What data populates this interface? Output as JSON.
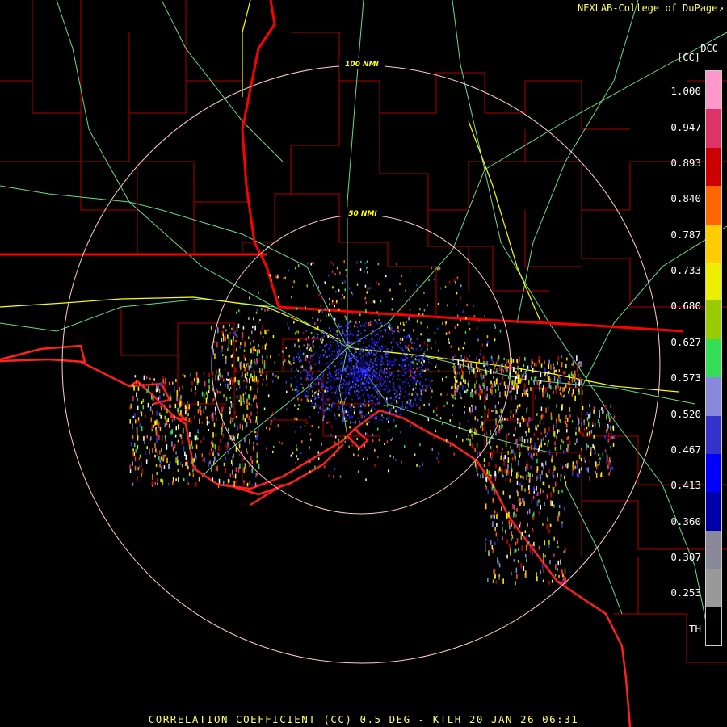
{
  "header": {
    "credit": "NEXLAB-College of DuPage",
    "credit_icon": "external-link-icon",
    "station": "DCC",
    "units": "[CC]"
  },
  "rings": {
    "inner_label": "50 NMI",
    "outer_label": "100 NMI"
  },
  "legend": {
    "labels": [
      "1.000",
      "0.947",
      "0.893",
      "0.840",
      "0.787",
      "0.733",
      "0.680",
      "0.627",
      "0.573",
      "0.520",
      "0.467",
      "0.413",
      "0.360",
      "0.307",
      "0.253",
      "TH"
    ],
    "colors": [
      "#ff99cc",
      "#dd3366",
      "#cc0000",
      "#ff6600",
      "#ffcc00",
      "#eeee00",
      "#99cc00",
      "#33dd55",
      "#8888dd",
      "#3333cc",
      "#0000ff",
      "#0000aa",
      "#888899",
      "#999999",
      "#000000"
    ]
  },
  "colors": {
    "state_border": "#ff0000",
    "county_border": "#cc0000",
    "highway": "#66dd88",
    "interstate": "#ffff00",
    "range_ring": "#ffcccc",
    "background": "#000000"
  },
  "footer": {
    "caption": "CORRELATION COEFFICIENT (CC) 0.5 DEG - KTLH 20 JAN 26 06:31"
  }
}
